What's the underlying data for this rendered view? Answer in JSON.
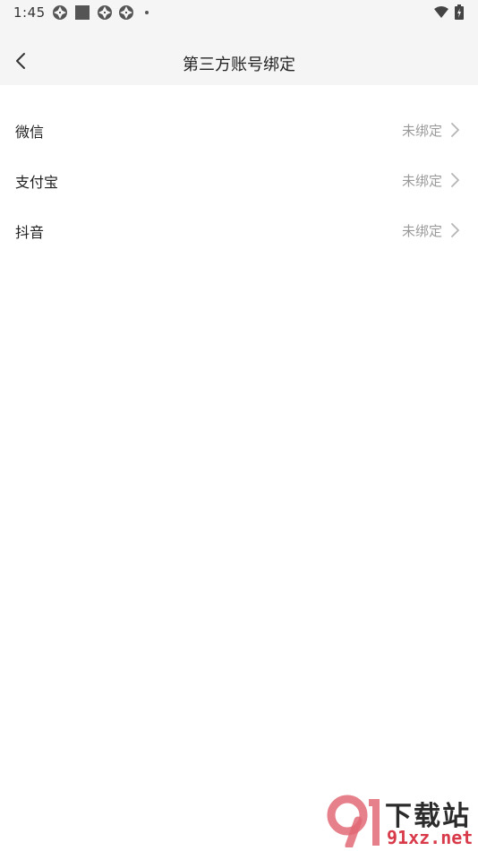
{
  "status_bar": {
    "time": "1:45"
  },
  "header": {
    "title": "第三方账号绑定"
  },
  "accounts": [
    {
      "label": "微信",
      "status": "未绑定"
    },
    {
      "label": "支付宝",
      "status": "未绑定"
    },
    {
      "label": "抖音",
      "status": "未绑定"
    }
  ],
  "watermark": {
    "title": "下载站",
    "url": "91xz.net"
  },
  "colors": {
    "header_bg": "#f5f5f5",
    "status_gray": "#9a9a9a",
    "watermark_red": "#d83a4a"
  }
}
